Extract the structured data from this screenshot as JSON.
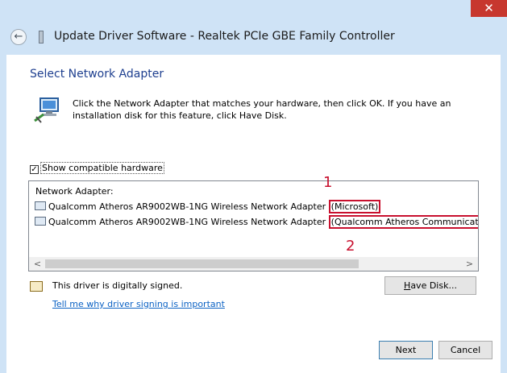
{
  "window": {
    "title": "Update Driver Software - Realtek PCIe GBE Family Controller",
    "close_glyph": "✕"
  },
  "dialog": {
    "heading": "Select Network Adapter",
    "instruction": "Click the Network Adapter that matches your hardware, then click OK. If you have an installation disk for this feature, click Have Disk.",
    "show_compatible": {
      "checked": true,
      "label": "Show compatible hardware",
      "check_glyph": "✓"
    },
    "list": {
      "header": "Network Adapter:",
      "items": [
        {
          "name": "Qualcomm Atheros AR9002WB-1NG Wireless Network Adapter",
          "provider": "(Microsoft)"
        },
        {
          "name": "Qualcomm Atheros AR9002WB-1NG Wireless Network Adapter",
          "provider": "(Qualcomm Atheros Communications"
        }
      ],
      "annotations": [
        "1",
        "2"
      ],
      "hscroll": {
        "left_arrow": "<",
        "right_arrow": ">",
        "thumb_start": 0.0,
        "thumb_fraction": 0.75
      }
    },
    "signed_text": "This driver is digitally signed.",
    "signing_link": "Tell me why driver signing is important",
    "buttons": {
      "have_disk": {
        "underlined": "H",
        "rest": "ave Disk..."
      },
      "next": "Next",
      "cancel": "Cancel"
    }
  },
  "colors": {
    "accent_heading": "#1e3f8f",
    "highlight_box": "#c8102e",
    "link": "#0b62c4",
    "close": "#c7372e"
  },
  "icons": [
    "close-icon",
    "back-arrow-icon",
    "device-icon",
    "network-adapter-icon",
    "adapter-item-icon",
    "certificate-icon"
  ]
}
